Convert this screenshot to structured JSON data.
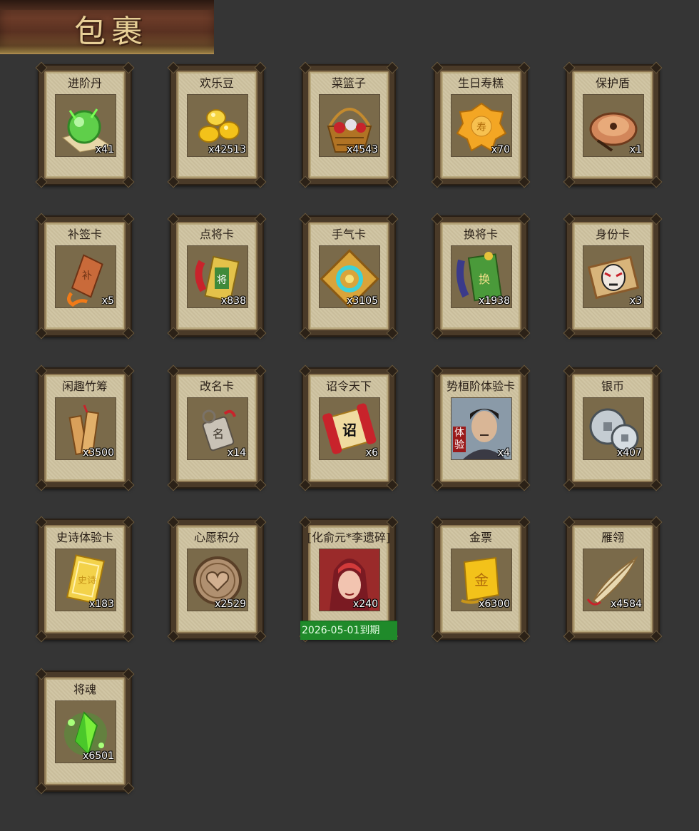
{
  "header": {
    "title": "包裹"
  },
  "items": [
    {
      "name": "进阶丹",
      "qty": "x41",
      "icon": "green-orb-icon"
    },
    {
      "name": "欢乐豆",
      "qty": "x42513",
      "icon": "gold-beans-icon"
    },
    {
      "name": "菜篮子",
      "qty": "x4543",
      "icon": "flower-basket-icon"
    },
    {
      "name": "生日寿糕",
      "qty": "x70",
      "icon": "birthday-cake-icon"
    },
    {
      "name": "保护盾",
      "qty": "x1",
      "icon": "round-shield-icon"
    },
    {
      "name": "补签卡",
      "qty": "x5",
      "icon": "signin-tablet-icon"
    },
    {
      "name": "点将卡",
      "qty": "x838",
      "icon": "general-card-icon"
    },
    {
      "name": "手气卡",
      "qty": "x3105",
      "icon": "luck-card-icon"
    },
    {
      "name": "换将卡",
      "qty": "x1938",
      "icon": "swap-card-icon"
    },
    {
      "name": "身份卡",
      "qty": "x3",
      "icon": "opera-mask-card-icon"
    },
    {
      "name": "闲趣竹筹",
      "qty": "x3500",
      "icon": "bamboo-tally-icon"
    },
    {
      "name": "改名卡",
      "qty": "x14",
      "icon": "rename-tag-icon"
    },
    {
      "name": "诏令天下",
      "qty": "x6",
      "icon": "edict-scroll-icon"
    },
    {
      "name": "势桓阶体验卡",
      "qty": "x4",
      "icon": "general-portrait-icon",
      "badge": "体验"
    },
    {
      "name": "银币",
      "qty": "x407",
      "icon": "silver-coins-icon"
    },
    {
      "name": "史诗体验卡",
      "qty": "x183",
      "icon": "gold-card-icon"
    },
    {
      "name": "心愿积分",
      "qty": "x2529",
      "icon": "heart-coin-icon"
    },
    {
      "name": "[化俞元*李遗碎]",
      "qty": "x240",
      "icon": "warrior-portrait-icon",
      "expire": "2026-05-01到期"
    },
    {
      "name": "金票",
      "qty": "x6300",
      "icon": "gold-ticket-icon"
    },
    {
      "name": "雁翎",
      "qty": "x4584",
      "icon": "feather-icon"
    },
    {
      "name": "将魂",
      "qty": "x6501",
      "icon": "green-crystal-icon"
    }
  ],
  "colors": {
    "background": "#353535",
    "card_inner": "#cfc3a0",
    "expire_bar": "#1f8a2a"
  }
}
